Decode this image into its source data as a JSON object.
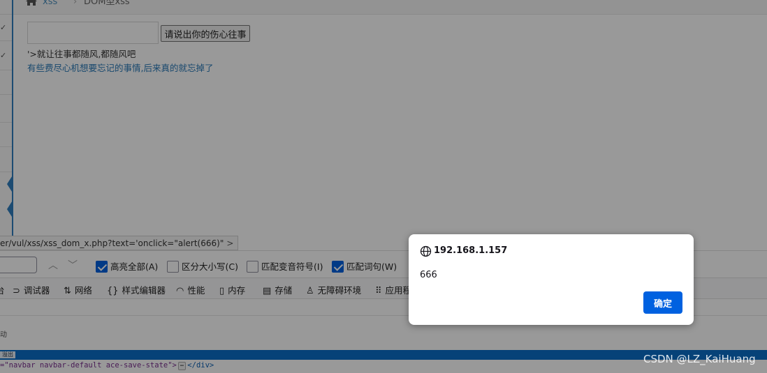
{
  "breadcrumb": {
    "section": "xss",
    "current": "DOM型xss"
  },
  "form": {
    "input_value": "",
    "button_label": "请说出你的伤心往事",
    "output_line1": "'>就让往事都随风,都随风吧",
    "output_line2": "有些费尽心机想要忘记的事情,后来真的就忘掉了"
  },
  "devtools": {
    "url_crumb": "er/vul/xss/xss_dom_x.php?text='onclick=\"alert(666)\"",
    "url_crumb_arrow": ">",
    "search": {
      "options": [
        {
          "label": "高亮全部(A)",
          "checked": true
        },
        {
          "label": "区分大小写(C)",
          "checked": false
        },
        {
          "label": "匹配变音符号(I)",
          "checked": false
        },
        {
          "label": "匹配词句(W)",
          "checked": true
        }
      ]
    },
    "tabs": [
      {
        "partial": "台"
      },
      {
        "label": "调试器",
        "icon": "debugger-icon"
      },
      {
        "label": "网络",
        "icon": "network-icon"
      },
      {
        "label": "样式编辑器",
        "icon": "style-editor-icon"
      },
      {
        "label": "性能",
        "icon": "performance-icon"
      },
      {
        "label": "内存",
        "icon": "memory-icon"
      },
      {
        "label": "存储",
        "icon": "storage-icon"
      },
      {
        "label": "无障碍环境",
        "icon": "accessibility-icon"
      },
      {
        "label": "应用程",
        "icon": "application-icon"
      }
    ],
    "side_text": "动",
    "status_tag": "溢出",
    "html_line": "=\"navbar navbar-default ace-save-state\">",
    "html_ellipsis": "⋯",
    "html_close": "</div>"
  },
  "dialog": {
    "origin": "192.168.1.157",
    "message": "666",
    "ok_label": "确定"
  },
  "watermark": "CSDN @LZ_KaiHuang",
  "colors": {
    "accent": "#0061e0",
    "sidebar_accent": "#2f7ebf",
    "link": "#4c8fbd"
  }
}
